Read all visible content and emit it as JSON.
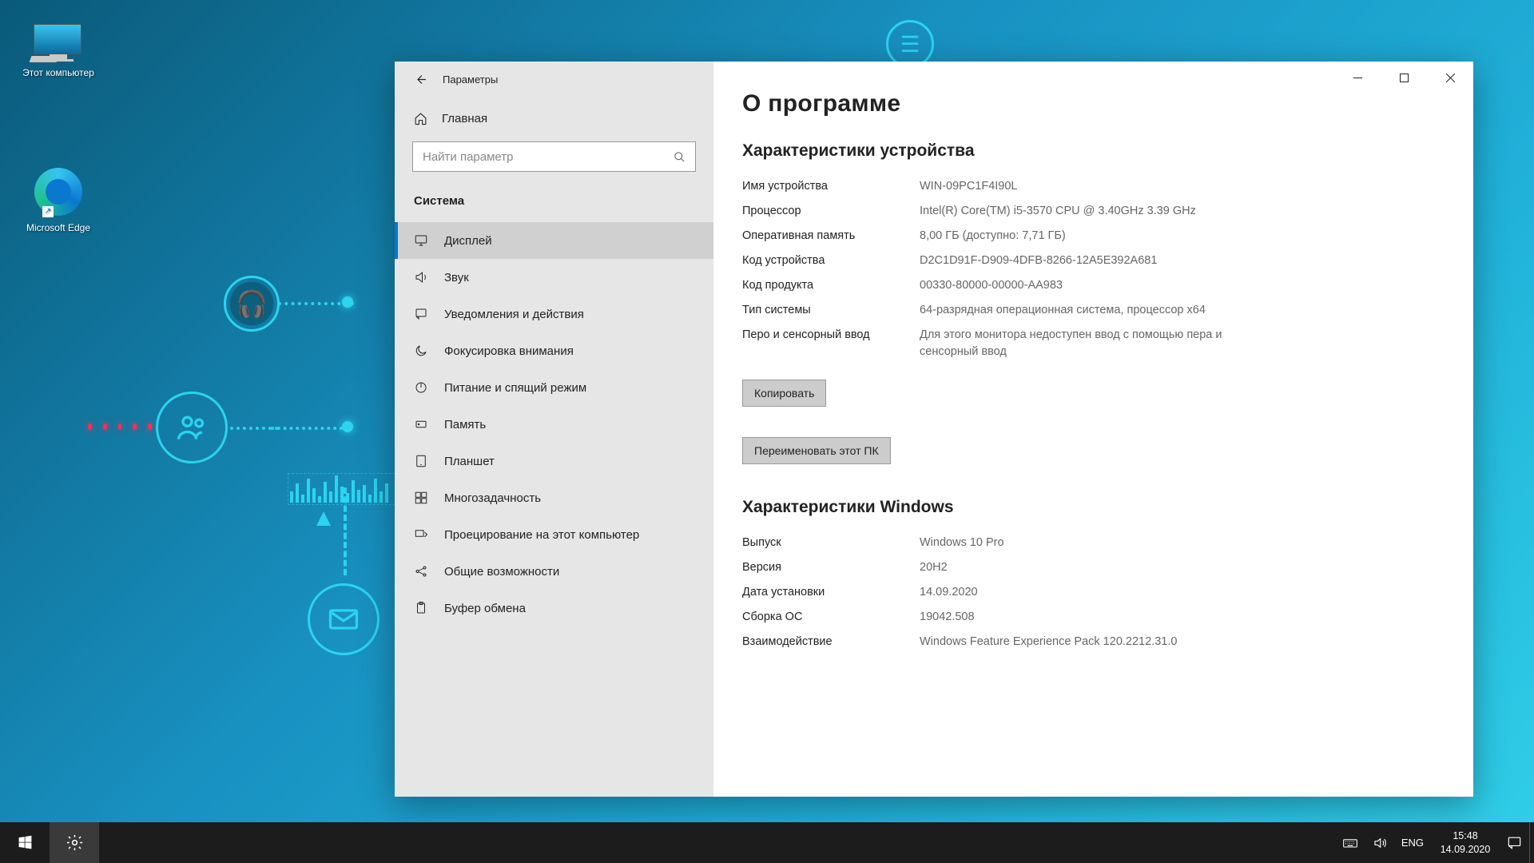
{
  "desktop": {
    "icons": [
      {
        "label": "Этот компьютер"
      },
      {
        "label": "Microsoft Edge"
      }
    ]
  },
  "window": {
    "title": "Параметры",
    "home_label": "Главная",
    "search_placeholder": "Найти параметр",
    "category_label": "Система",
    "nav": [
      {
        "label": "Дисплей"
      },
      {
        "label": "Звук"
      },
      {
        "label": "Уведомления и действия"
      },
      {
        "label": "Фокусировка внимания"
      },
      {
        "label": "Питание и спящий режим"
      },
      {
        "label": "Память"
      },
      {
        "label": "Планшет"
      },
      {
        "label": "Многозадачность"
      },
      {
        "label": "Проецирование на этот компьютер"
      },
      {
        "label": "Общие возможности"
      },
      {
        "label": "Буфер обмена"
      }
    ],
    "page_title": "О программе",
    "device_section": "Характеристики устройства",
    "device_specs": [
      {
        "k": "Имя устройства",
        "v": "WIN-09PC1F4I90L"
      },
      {
        "k": "Процессор",
        "v": "Intel(R) Core(TM) i5-3570 CPU @ 3.40GHz 3.39 GHz"
      },
      {
        "k": "Оперативная память",
        "v": "8,00 ГБ (доступно: 7,71 ГБ)"
      },
      {
        "k": "Код устройства",
        "v": "D2C1D91F-D909-4DFB-8266-12A5E392A681"
      },
      {
        "k": "Код продукта",
        "v": "00330-80000-00000-AA983"
      },
      {
        "k": "Тип системы",
        "v": "64-разрядная операционная система, процессор x64"
      },
      {
        "k": "Перо и сенсорный ввод",
        "v": "Для этого монитора недоступен ввод с помощью пера и сенсорный ввод"
      }
    ],
    "copy_btn": "Копировать",
    "rename_btn": "Переименовать этот ПК",
    "win_section": "Характеристики Windows",
    "win_specs": [
      {
        "k": "Выпуск",
        "v": "Windows 10 Pro"
      },
      {
        "k": "Версия",
        "v": "20H2"
      },
      {
        "k": "Дата установки",
        "v": "14.09.2020"
      },
      {
        "k": "Сборка ОС",
        "v": "19042.508"
      },
      {
        "k": "Взаимодействие",
        "v": "Windows Feature Experience Pack 120.2212.31.0"
      }
    ]
  },
  "taskbar": {
    "lang": "ENG",
    "time": "15:48",
    "date": "14.09.2020"
  }
}
